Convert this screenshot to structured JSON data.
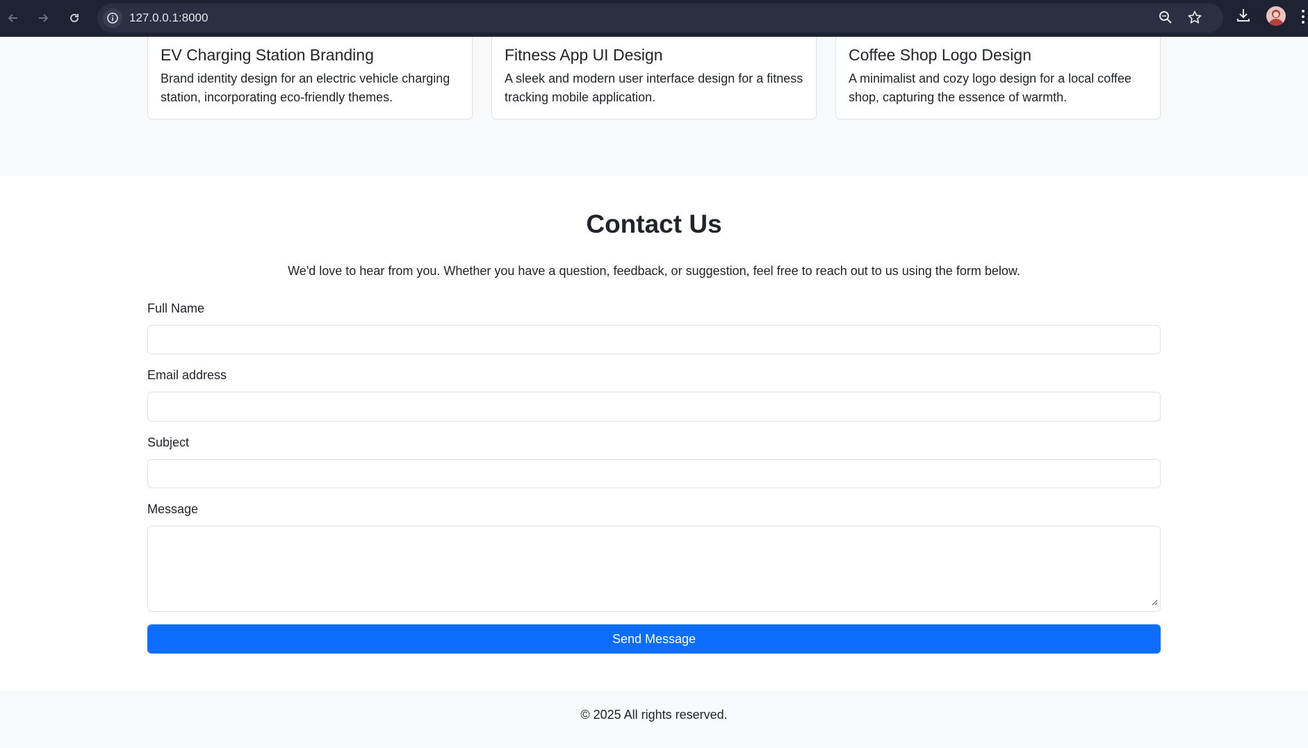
{
  "browser": {
    "url": "127.0.0.1:8000",
    "icons": [
      "back-arrow-icon",
      "forward-arrow-icon",
      "reload-icon",
      "info-icon",
      "zoom-icon",
      "star-icon",
      "download-icon",
      "avatar",
      "kebab-menu-icon"
    ]
  },
  "portfolio": {
    "cards": [
      {
        "title": "EV Charging Station Branding",
        "description": "Brand identity design for an electric vehicle charging station, incorporating eco-friendly themes."
      },
      {
        "title": "Fitness App UI Design",
        "description": "A sleek and modern user interface design for a fitness tracking mobile application."
      },
      {
        "title": "Coffee Shop Logo Design",
        "description": "A minimalist and cozy logo design for a local coffee shop, capturing the essence of warmth."
      }
    ]
  },
  "contact": {
    "title": "Contact Us",
    "lead": "We'd love to hear from you. Whether you have a question, feedback, or suggestion, feel free to reach out to us using the form below.",
    "fields": {
      "name_label": "Full Name",
      "name_value": "",
      "email_label": "Email address",
      "email_value": "",
      "subject_label": "Subject",
      "subject_value": "",
      "message_label": "Message",
      "message_value": ""
    },
    "submit_label": "Send Message"
  },
  "footer": {
    "text": "© 2025 All rights reserved."
  },
  "colors": {
    "primary": "#0d6efd",
    "section_bg": "#f8f9fa",
    "border": "#dee2e6",
    "browser_bar": "#1f2233"
  }
}
